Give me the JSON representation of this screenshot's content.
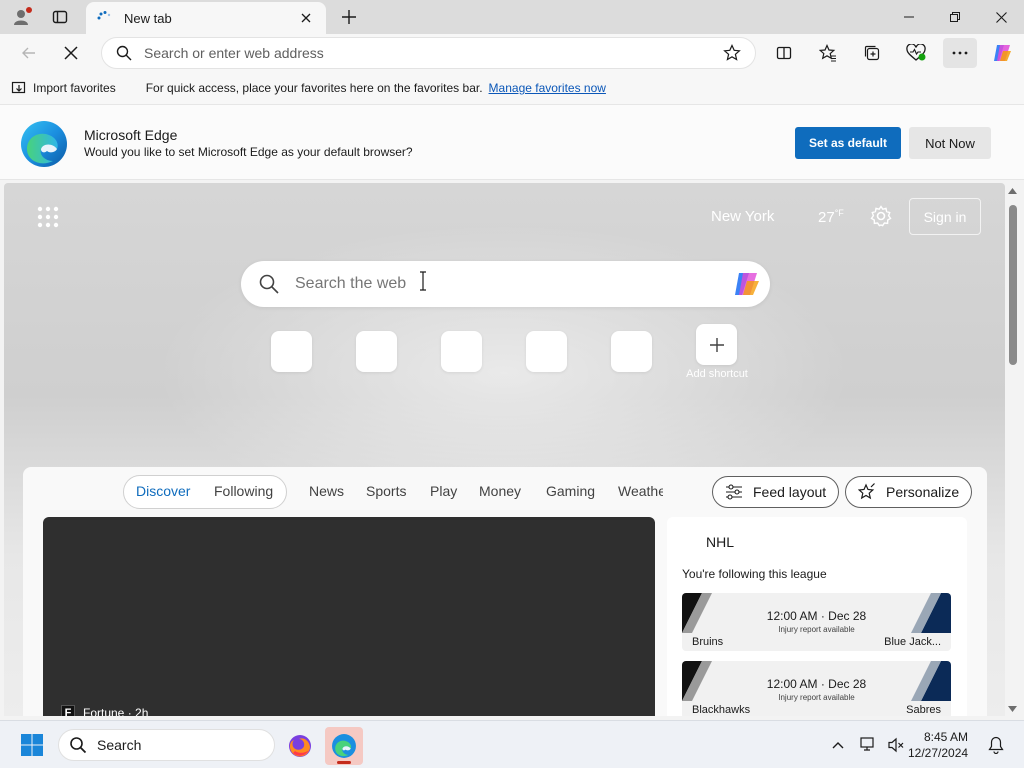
{
  "browser": {
    "tab_title": "New tab",
    "address_placeholder": "Search or enter web address"
  },
  "favorites_bar": {
    "import_label": "Import favorites",
    "message": "For quick access, place your favorites here on the favorites bar.",
    "manage_link": "Manage favorites now"
  },
  "banner": {
    "title": "Microsoft Edge",
    "subtitle": "Would you like to set Microsoft Edge as your default browser?",
    "set_default_label": "Set as default",
    "not_now_label": "Not Now"
  },
  "new_tab_page": {
    "city": "New York",
    "temperature": "27",
    "temperature_unit": "°F",
    "sign_in_label": "Sign in",
    "search_placeholder": "Search the web",
    "add_shortcut_label": "Add shortcut"
  },
  "feed": {
    "tabs": [
      "Discover",
      "Following",
      "News",
      "Sports",
      "Play",
      "Money",
      "Gaming",
      "Weathe"
    ],
    "active_tab": "Discover",
    "feed_layout_label": "Feed layout",
    "personalize_label": "Personalize",
    "hero_source_badge": "F",
    "hero_source": "Fortune · 2h"
  },
  "nhl": {
    "title": "NHL",
    "subtitle": "You're following this league",
    "games": [
      {
        "time": "12:00 AM · Dec 28",
        "note": "Injury report available",
        "home": "Bruins",
        "away": "Blue Jack..."
      },
      {
        "time": "12:00 AM · Dec 28",
        "note": "Injury report available",
        "home": "Blackhawks",
        "away": "Sabres"
      }
    ]
  },
  "taskbar": {
    "search_label": "Search",
    "time": "8:45 AM",
    "date": "12/27/2024"
  },
  "colors": {
    "accent": "#0f6cbd",
    "link": "#0b57b8",
    "taskbar_bg": "#eef1f6"
  }
}
